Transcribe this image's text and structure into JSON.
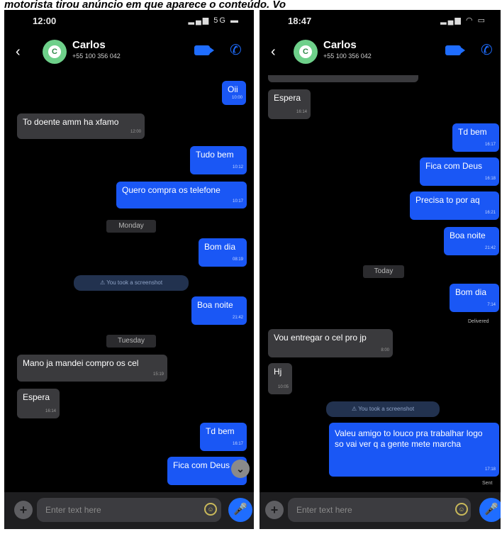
{
  "banner": "motorista tirou anúncio em que aparece o conteúdo. Vo",
  "left": {
    "status_time": "12:00",
    "status_icons": "▂▄▆ 5G ▬",
    "contact_name": "Carlos",
    "contact_number": "+55 100 356 042",
    "messages": [
      {
        "text": "Oii",
        "time": "10:00"
      },
      {
        "text": "To doente amm ha xfamo",
        "time": "12:00"
      },
      {
        "text": "Tudo bem",
        "time": "10:12"
      },
      {
        "text": "Quero compra os telefone",
        "time": "10:17"
      },
      {
        "text": "Monday"
      },
      {
        "text": "Bom dia",
        "time": "08:19"
      },
      {
        "text": "You took a screenshot"
      },
      {
        "text": "Boa noite",
        "time": "21:42"
      },
      {
        "text": "Tuesday"
      },
      {
        "text": "Mano ja mandei compro os cel",
        "time": "15:19"
      },
      {
        "text": "Espera",
        "time": "16:14"
      },
      {
        "text": "Td bem",
        "time": "16:17"
      },
      {
        "text": "Fica com Deus"
      }
    ],
    "composer_placeholder": "Enter text here"
  },
  "right": {
    "status_time": "18:47",
    "status_icons": "▂▄▆ ◠ ▭",
    "contact_name": "Carlos",
    "contact_number": "+55 100 356 042",
    "messages": [
      {
        "text": "Espera",
        "time": "16:14"
      },
      {
        "text": "Td bem",
        "time": "16:17"
      },
      {
        "text": "Fica com Deus",
        "time": "16:18"
      },
      {
        "text": "Precisa to por aq",
        "time": "16:21"
      },
      {
        "text": "Boa noite",
        "time": "21:42"
      },
      {
        "text": "Today"
      },
      {
        "text": "Bom dia",
        "time": "7:14"
      },
      {
        "text": "Delivered"
      },
      {
        "text": "Vou entregar o cel pro jp",
        "time": "8:00"
      },
      {
        "text": "Hj",
        "time": "10:05"
      },
      {
        "text": "You took a screenshot"
      },
      {
        "text": "Valeu amigo to louco pra trabalhar logo so vai ver q a gente mete marcha",
        "time": "17:18"
      },
      {
        "text": "Sent"
      }
    ],
    "composer_placeholder": "Enter text here"
  },
  "icons": {
    "back": "chevron-left-icon",
    "video": "video-camera-icon",
    "call": "phone-icon",
    "attach": "plus-icon",
    "emoji": "emoji-icon",
    "mic": "microphone-icon",
    "scroll": "chevron-down-icon"
  },
  "colors": {
    "outgoing_bubble": "#1a57f5",
    "incoming_bubble": "#3a3a3d",
    "avatar": "#6ed08a",
    "accent": "#1f6dff"
  }
}
